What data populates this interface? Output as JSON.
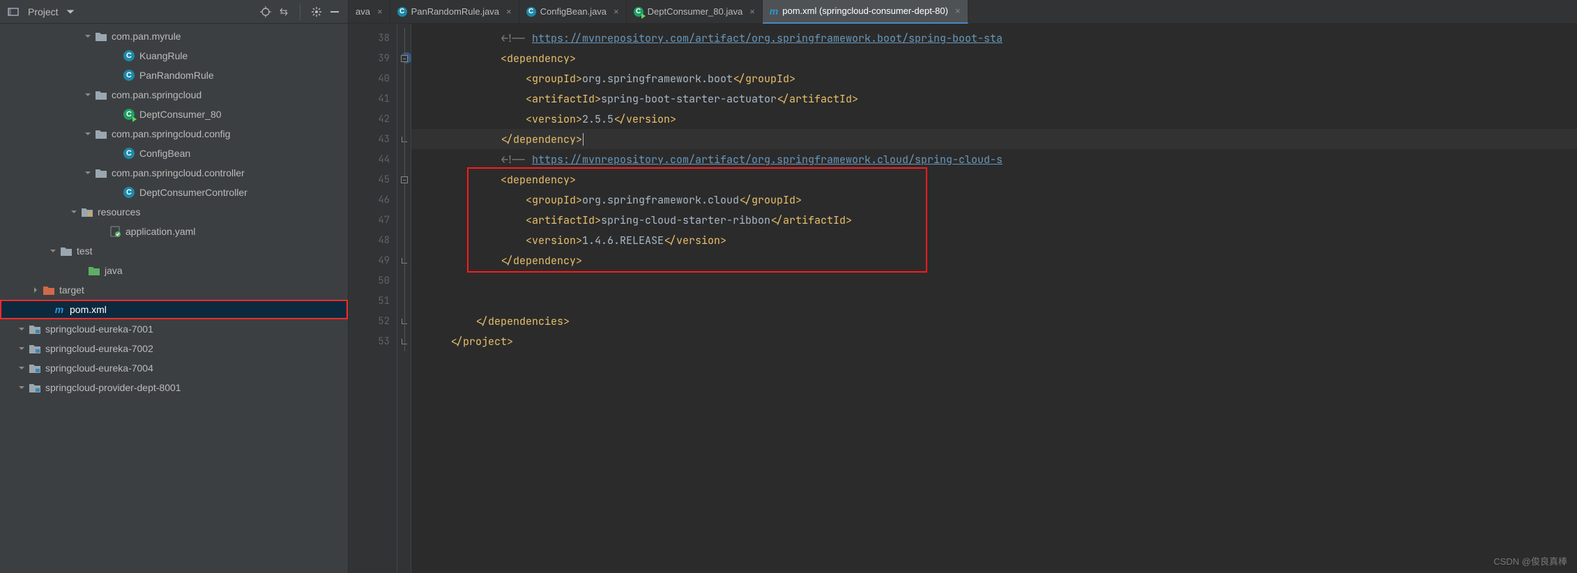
{
  "project": {
    "title": "Project",
    "tree": [
      {
        "indent": 120,
        "arrow": "down",
        "icon": "package",
        "label": "com.pan.myrule"
      },
      {
        "indent": 160,
        "arrow": "none",
        "icon": "class",
        "label": "KuangRule"
      },
      {
        "indent": 160,
        "arrow": "none",
        "icon": "class",
        "label": "PanRandomRule"
      },
      {
        "indent": 120,
        "arrow": "down",
        "icon": "package",
        "label": "com.pan.springcloud"
      },
      {
        "indent": 160,
        "arrow": "none",
        "icon": "runclass",
        "label": "DeptConsumer_80"
      },
      {
        "indent": 120,
        "arrow": "down",
        "icon": "package",
        "label": "com.pan.springcloud.config"
      },
      {
        "indent": 160,
        "arrow": "none",
        "icon": "class",
        "label": "ConfigBean"
      },
      {
        "indent": 120,
        "arrow": "down",
        "icon": "package",
        "label": "com.pan.springcloud.controller"
      },
      {
        "indent": 160,
        "arrow": "none",
        "icon": "class",
        "label": "DeptConsumerController"
      },
      {
        "indent": 100,
        "arrow": "down",
        "icon": "resfolder",
        "label": "resources"
      },
      {
        "indent": 140,
        "arrow": "none",
        "icon": "yaml",
        "label": "application.yaml"
      },
      {
        "indent": 70,
        "arrow": "down",
        "icon": "folder",
        "label": "test"
      },
      {
        "indent": 110,
        "arrow": "none",
        "icon": "javafolder",
        "label": "java"
      },
      {
        "indent": 45,
        "arrow": "right",
        "icon": "targetfolder",
        "label": "target"
      },
      {
        "indent": 60,
        "arrow": "none",
        "icon": "maven",
        "label": "pom.xml",
        "selected": true,
        "pomhl": true
      },
      {
        "indent": 25,
        "arrow": "down",
        "icon": "modfolder",
        "label": "springcloud-eureka-7001"
      },
      {
        "indent": 25,
        "arrow": "down",
        "icon": "modfolder",
        "label": "springcloud-eureka-7002"
      },
      {
        "indent": 25,
        "arrow": "down",
        "icon": "modfolder",
        "label": "springcloud-eureka-7004"
      },
      {
        "indent": 25,
        "arrow": "down",
        "icon": "modfolder",
        "label": "springcloud-provider-dept-8001"
      }
    ]
  },
  "toolbar_icons": [
    "locate-icon",
    "collapse-icon",
    "gear-icon",
    "hide-icon"
  ],
  "tabs": [
    {
      "label": "ava",
      "icon": "none",
      "close": true,
      "active": false
    },
    {
      "label": "PanRandomRule.java",
      "icon": "class",
      "close": true,
      "active": false
    },
    {
      "label": "ConfigBean.java",
      "icon": "class",
      "close": true,
      "active": false
    },
    {
      "label": "DeptConsumer_80.java",
      "icon": "runclass",
      "close": true,
      "active": false
    },
    {
      "label": "pom.xml (springcloud-consumer-dept-80)",
      "icon": "maven",
      "close": true,
      "active": true
    }
  ],
  "gutter_start": 38,
  "gutter_count": 16,
  "run_marker_line": 39,
  "code_lines": [
    {
      "n": 38,
      "indent": 3,
      "parts": [
        {
          "c": "grey",
          "t": "<!-- "
        },
        {
          "c": "link",
          "t": "https://mvnrepository.com/artifact/org.springframework.boot/spring-boot-sta"
        }
      ]
    },
    {
      "n": 39,
      "indent": 3,
      "parts": [
        {
          "c": "tag",
          "t": "<dependency>"
        }
      ]
    },
    {
      "n": 40,
      "indent": 4,
      "parts": [
        {
          "c": "tag",
          "t": "<groupId>"
        },
        {
          "c": "text",
          "t": "org.springframework.boot"
        },
        {
          "c": "tag",
          "t": "</groupId>"
        }
      ]
    },
    {
      "n": 41,
      "indent": 4,
      "parts": [
        {
          "c": "tag",
          "t": "<artifactId>"
        },
        {
          "c": "text",
          "t": "spring-boot-starter-actuator"
        },
        {
          "c": "tag",
          "t": "</artifactId>"
        }
      ]
    },
    {
      "n": 42,
      "indent": 4,
      "parts": [
        {
          "c": "tag",
          "t": "<version>"
        },
        {
          "c": "text",
          "t": "2.5.5"
        },
        {
          "c": "tag",
          "t": "</version>"
        }
      ]
    },
    {
      "n": 43,
      "indent": 3,
      "hl": true,
      "parts": [
        {
          "c": "tag",
          "t": "</dependency>"
        }
      ],
      "caret": true
    },
    {
      "n": 44,
      "indent": 3,
      "parts": [
        {
          "c": "grey",
          "t": "<!-- "
        },
        {
          "c": "link",
          "t": "https://mvnrepository.com/artifact/org.springframework.cloud/spring-cloud-s"
        }
      ]
    },
    {
      "n": 45,
      "indent": 3,
      "parts": [
        {
          "c": "tag",
          "t": "<dependency>"
        }
      ]
    },
    {
      "n": 46,
      "indent": 4,
      "parts": [
        {
          "c": "tag",
          "t": "<groupId>"
        },
        {
          "c": "text",
          "t": "org.springframework.cloud"
        },
        {
          "c": "tag",
          "t": "</groupId>"
        }
      ]
    },
    {
      "n": 47,
      "indent": 4,
      "parts": [
        {
          "c": "tag",
          "t": "<artifactId>"
        },
        {
          "c": "text",
          "t": "spring-cloud-starter-ribbon"
        },
        {
          "c": "tag",
          "t": "</artifactId>"
        }
      ]
    },
    {
      "n": 48,
      "indent": 4,
      "parts": [
        {
          "c": "tag",
          "t": "<version>"
        },
        {
          "c": "text",
          "t": "1.4.6.RELEASE"
        },
        {
          "c": "tag",
          "t": "</version>"
        }
      ]
    },
    {
      "n": 49,
      "indent": 3,
      "parts": [
        {
          "c": "tag",
          "t": "</dependency>"
        }
      ]
    },
    {
      "n": 50,
      "indent": 3,
      "parts": []
    },
    {
      "n": 51,
      "indent": 3,
      "parts": []
    },
    {
      "n": 52,
      "indent": 2,
      "parts": [
        {
          "c": "tag",
          "t": "</dependencies>"
        }
      ]
    },
    {
      "n": 53,
      "indent": 1,
      "parts": [
        {
          "c": "tag",
          "t": "</project>"
        }
      ]
    }
  ],
  "watermark": "CSDN @俊良真棒"
}
